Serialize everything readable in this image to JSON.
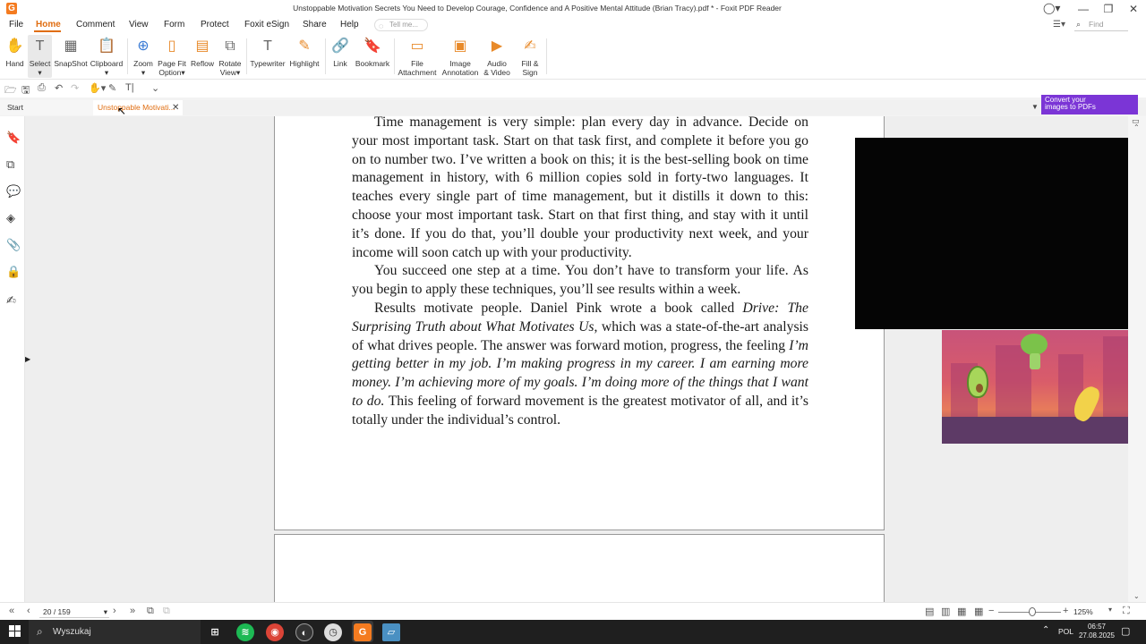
{
  "window": {
    "title": "Unstoppable Motivation Secrets You Need to Develop Courage, Confidence and A Positive Mental Attitude (Brian Tracy).pdf * - Foxit PDF Reader",
    "logo_letter": "G"
  },
  "menu": {
    "items": [
      "File",
      "Home",
      "Comment",
      "View",
      "Form",
      "Protect",
      "Foxit eSign",
      "Share",
      "Help"
    ],
    "tell_me_placeholder": "Tell me...",
    "find_placeholder": "Find"
  },
  "ribbon": {
    "buttons": [
      {
        "l1": "Hand",
        "l2": ""
      },
      {
        "l1": "Select",
        "l2": ""
      },
      {
        "l1": "SnapShot",
        "l2": ""
      },
      {
        "l1": "Clipboard",
        "l2": ""
      },
      {
        "l1": "Zoom",
        "l2": ""
      },
      {
        "l1": "Page Fit",
        "l2": "Option"
      },
      {
        "l1": "Reflow",
        "l2": ""
      },
      {
        "l1": "Rotate",
        "l2": "View"
      },
      {
        "l1": "Typewriter",
        "l2": ""
      },
      {
        "l1": "Highlight",
        "l2": ""
      },
      {
        "l1": "Link",
        "l2": ""
      },
      {
        "l1": "Bookmark",
        "l2": ""
      },
      {
        "l1": "File",
        "l2": "Attachment"
      },
      {
        "l1": "Image",
        "l2": "Annotation"
      },
      {
        "l1": "Audio",
        "l2": "& Video"
      },
      {
        "l1": "Fill &",
        "l2": "Sign"
      }
    ]
  },
  "tabs": {
    "start": "Start",
    "document": "Unstoppable Motivati..."
  },
  "banner": {
    "line1": "Convert your",
    "line2": "images to PDFs"
  },
  "document": {
    "paragraphs": [
      "Time management is very simple: plan every day in advance. Decide on your most important task. Start on that task first, and complete it before you go on to number two. I’ve written a book on this; it is the best-selling book on time management in history, with 6 million copies sold in forty-two languages. It teaches every single part of time management, but it distills it down to this: choose your most important task. Start on that first thing, and stay with it until it’s done. If you do that, you’ll double your productivity next week, and your income will soon catch up with your productivity.",
      "You succeed one step at a time. You don’t have to transform your life. As you begin to apply these techniques, you’ll see results within a week."
    ],
    "p3_a": "Results motivate people. Daniel Pink wrote a book called ",
    "p3_title": "Drive: The Surprising Truth about What Motivates Us",
    "p3_b": ", which was a state-of-the-art analysis of what drives people. The answer was forward motion, progress, the feeling ",
    "p3_quote": "I’m getting better in my job. I’m making progress in my career. I am earning more money. I’m achieving more of my goals. I’m doing more of the things that I want to do.",
    "p3_c": " This feeling of forward movement is the greatest motivator of all, and it’s totally under the individual’s control."
  },
  "status": {
    "page": "20 / 159",
    "zoom": "125%"
  },
  "taskbar": {
    "search": "Wyszukaj",
    "lang": "POL",
    "time": "06:57",
    "date": "27.08.2025"
  }
}
